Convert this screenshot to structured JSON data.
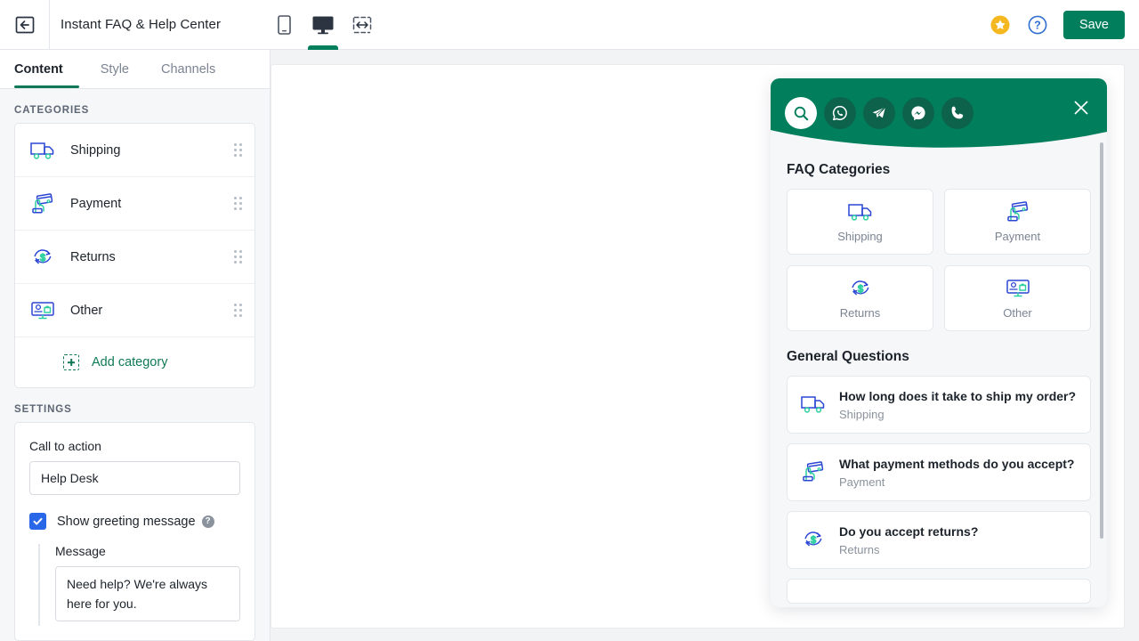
{
  "header": {
    "back_icon": "back-arrow-icon",
    "title": "Instant FAQ & Help Center",
    "devices": [
      {
        "name": "mobile-preview",
        "icon": "mobile-icon",
        "active": false
      },
      {
        "name": "desktop-preview",
        "icon": "desktop-icon",
        "active": true
      },
      {
        "name": "responsive-preview",
        "icon": "resize-arrows-icon",
        "active": false
      }
    ],
    "star_icon": "star-icon",
    "help_icon": "question-circle-icon",
    "save_label": "Save"
  },
  "tabs": [
    {
      "label": "Content",
      "active": true
    },
    {
      "label": "Style",
      "active": false
    },
    {
      "label": "Channels",
      "active": false
    }
  ],
  "sidebar": {
    "categories_label": "CATEGORIES",
    "categories": [
      {
        "label": "Shipping",
        "icon": "truck-icon"
      },
      {
        "label": "Payment",
        "icon": "hand-card-icon"
      },
      {
        "label": "Returns",
        "icon": "refresh-dollar-icon"
      },
      {
        "label": "Other",
        "icon": "monitor-bag-icon"
      }
    ],
    "add_category_label": "Add category",
    "settings_label": "SETTINGS",
    "call_to_action_label": "Call to action",
    "call_to_action_value": "Help Desk",
    "show_greeting_label": "Show greeting message",
    "show_greeting_checked": true,
    "message_label": "Message",
    "message_value": "Need help? We're always here for you."
  },
  "widget": {
    "channels": [
      {
        "name": "search",
        "icon": "search-icon",
        "active": true
      },
      {
        "name": "whatsapp",
        "icon": "whatsapp-icon",
        "active": false
      },
      {
        "name": "telegram",
        "icon": "telegram-icon",
        "active": false
      },
      {
        "name": "messenger",
        "icon": "messenger-icon",
        "active": false
      },
      {
        "name": "phone",
        "icon": "phone-icon",
        "active": false
      }
    ],
    "close_icon": "close-icon",
    "categories_heading": "FAQ Categories",
    "categories": [
      {
        "label": "Shipping",
        "icon": "truck-icon"
      },
      {
        "label": "Payment",
        "icon": "hand-card-icon"
      },
      {
        "label": "Returns",
        "icon": "refresh-dollar-icon"
      },
      {
        "label": "Other",
        "icon": "monitor-bag-icon"
      }
    ],
    "questions_heading": "General Questions",
    "questions": [
      {
        "title": "How long does it take to ship my order?",
        "category": "Shipping",
        "icon": "truck-icon"
      },
      {
        "title": "What payment methods do you accept?",
        "category": "Payment",
        "icon": "hand-card-icon"
      },
      {
        "title": "Do you accept returns?",
        "category": "Returns",
        "icon": "refresh-dollar-icon"
      }
    ]
  },
  "colors": {
    "brand_green": "#017f5c",
    "channel_dark_green": "#0c624a",
    "checkbox_blue": "#2767e8",
    "icon_blue": "#2b46d4",
    "icon_teal": "#2ecfa0",
    "star_yellow": "#f5b820"
  }
}
